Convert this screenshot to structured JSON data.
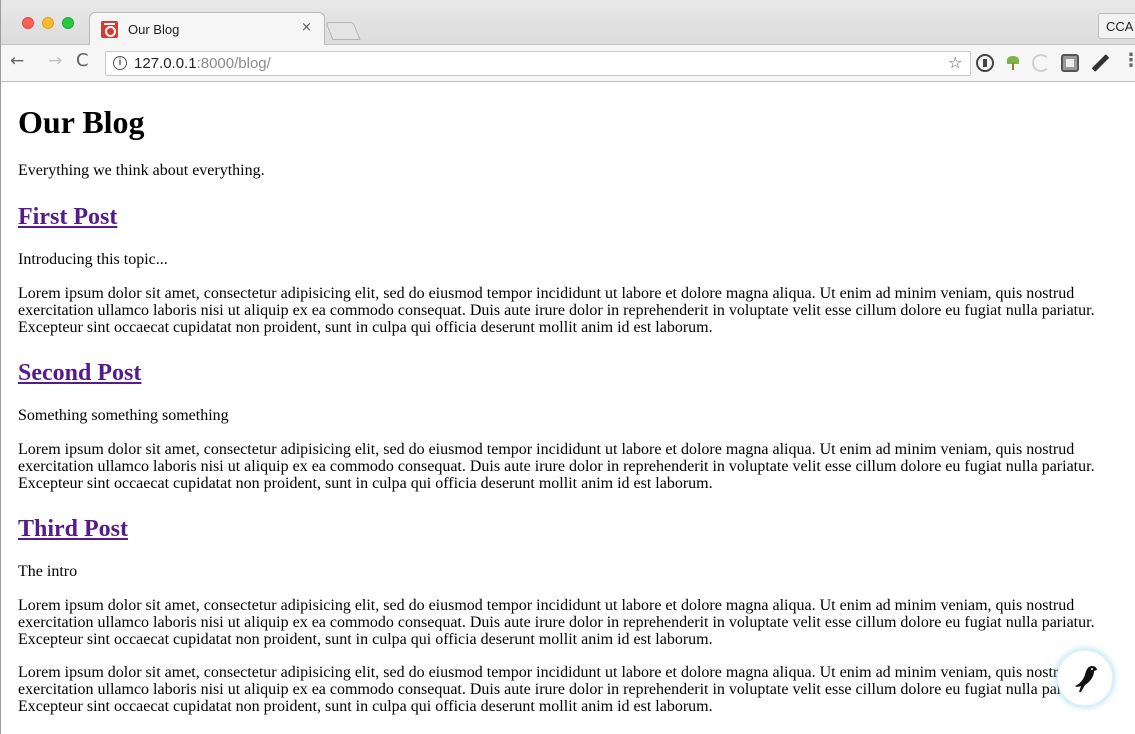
{
  "browser": {
    "tab": {
      "title": "Our Blog",
      "close_glyph": "×",
      "favicon": "site-favicon-icon"
    },
    "profile_label": "CCA",
    "nav": {
      "back_glyph": "←",
      "forward_glyph": "→",
      "reload_glyph": "C"
    },
    "omnibox": {
      "info_glyph": "i",
      "url_host": "127.0.0.1",
      "url_rest": ":8000/blog/",
      "star_glyph": "☆"
    },
    "extensions": [
      "onepassword-icon",
      "leaf-extension-icon",
      "swirl-extension-icon",
      "square-extension-icon",
      "pencil-extension-icon"
    ],
    "menu_glyph": "⋮"
  },
  "blog": {
    "title": "Our Blog",
    "tagline": "Everything we think about everything.",
    "posts": [
      {
        "title": "First Post",
        "intro": "Introducing this topic...",
        "paragraphs": [
          "Lorem ipsum dolor sit amet, consectetur adipisicing elit, sed do eiusmod tempor incididunt ut labore et dolore magna aliqua. Ut enim ad minim veniam, quis nostrud exercitation ullamco laboris nisi ut aliquip ex ea commodo consequat. Duis aute irure dolor in reprehenderit in voluptate velit esse cillum dolore eu fugiat nulla pariatur. Excepteur sint occaecat cupidatat non proident, sunt in culpa qui officia deserunt mollit anim id est laborum."
        ]
      },
      {
        "title": "Second Post",
        "intro": "Something something something",
        "paragraphs": [
          "Lorem ipsum dolor sit amet, consectetur adipisicing elit, sed do eiusmod tempor incididunt ut labore et dolore magna aliqua. Ut enim ad minim veniam, quis nostrud exercitation ullamco laboris nisi ut aliquip ex ea commodo consequat. Duis aute irure dolor in reprehenderit in voluptate velit esse cillum dolore eu fugiat nulla pariatur. Excepteur sint occaecat cupidatat non proident, sunt in culpa qui officia deserunt mollit anim id est laborum."
        ]
      },
      {
        "title": "Third Post",
        "intro": "The intro",
        "paragraphs": [
          "Lorem ipsum dolor sit amet, consectetur adipisicing elit, sed do eiusmod tempor incididunt ut labore et dolore magna aliqua. Ut enim ad minim veniam, quis nostrud exercitation ullamco laboris nisi ut aliquip ex ea commodo consequat. Duis aute irure dolor in reprehenderit in voluptate velit esse cillum dolore eu fugiat nulla pariatur. Excepteur sint occaecat cupidatat non proident, sunt in culpa qui officia deserunt mollit anim id est laborum.",
          "Lorem ipsum dolor sit amet, consectetur adipisicing elit, sed do eiusmod tempor incididunt ut labore et dolore magna aliqua. Ut enim ad minim veniam, quis nostrud exercitation ullamco laboris nisi ut aliquip ex ea commodo consequat. Duis aute irure dolor in reprehenderit in voluptate velit esse cillum dolore eu fugiat nulla pariatur. Excepteur sint occaecat cupidatat non proident, sunt in culpa qui officia deserunt mollit anim id est laborum."
        ]
      }
    ]
  },
  "fab_icon": "bird-icon",
  "colors": {
    "link_visited": "#551a8b",
    "favicon_red": "#d63a32",
    "fab_glow": "#8cd2eb"
  }
}
